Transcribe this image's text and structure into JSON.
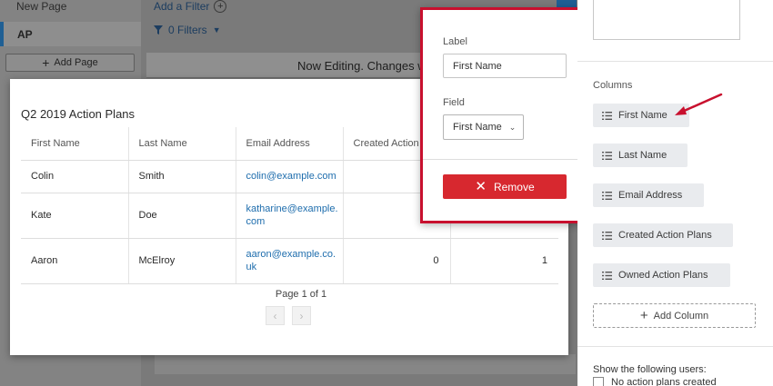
{
  "left_nav": {
    "new_page": "New Page",
    "active_page": "AP",
    "add_page_label": "Add Page"
  },
  "toolbar": {
    "add_filter_label": "Add a Filter",
    "filters_label": "0 Filters",
    "editing_banner": "Now Editing. Changes wi"
  },
  "report": {
    "title": "Q2 2019 Action Plans",
    "columns": [
      "First Name",
      "Last Name",
      "Email Address",
      "Created Action P"
    ],
    "rows": [
      {
        "first": "Colin",
        "last": "Smith",
        "email": "colin@example.com",
        "created": "",
        "owned": ""
      },
      {
        "first": "Kate",
        "last": "Doe",
        "email": "katharine@example.com",
        "created": "",
        "owned": ""
      },
      {
        "first": "Aaron",
        "last": "McElroy",
        "email": "aaron@example.co.uk",
        "created": "0",
        "owned": "1"
      }
    ],
    "pagination": "Page 1 of 1"
  },
  "popover": {
    "label_heading": "Label",
    "label_value": "First Name",
    "field_heading": "Field",
    "field_value": "First Name",
    "remove_label": "Remove"
  },
  "sidebar": {
    "columns_heading": "Columns",
    "columns": [
      "First Name",
      "Last Name",
      "Email Address",
      "Created Action Plans",
      "Owned Action Plans"
    ],
    "add_column_label": "Add Column",
    "show_users_label": "Show the following users:",
    "checkbox_label": "No action plans created"
  },
  "colors": {
    "accent_red": "#c8102e",
    "remove_red": "#d7282f",
    "link_blue": "#1e6dad",
    "nav_blue": "#1f5f94"
  },
  "icons": [
    "plus-icon",
    "circle-plus-icon",
    "filter-icon",
    "chevron-down-icon",
    "close-icon",
    "list-icon",
    "chevron-left-icon",
    "chevron-right-icon",
    "pointer-arrow-icon"
  ]
}
